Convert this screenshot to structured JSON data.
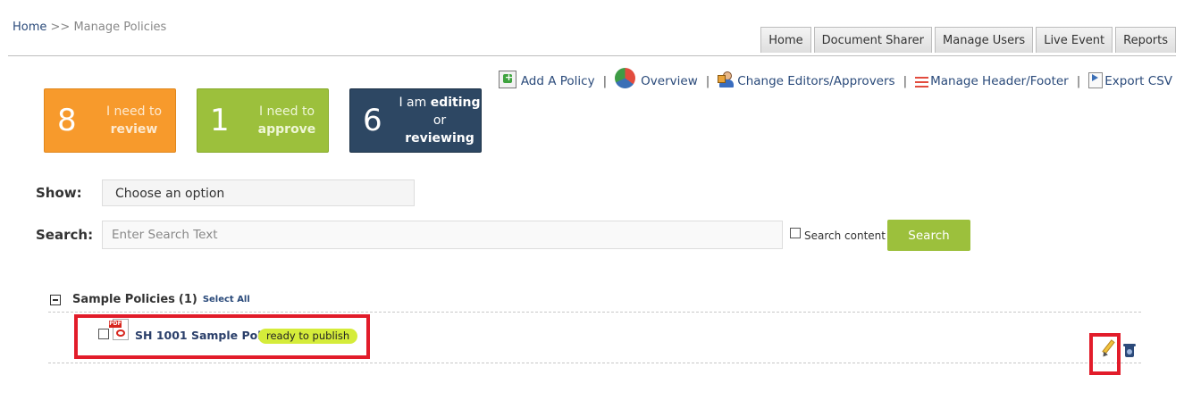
{
  "breadcrumb": {
    "home": "Home",
    "separator": ">>",
    "current": "Manage Policies"
  },
  "topnav": [
    "Home",
    "Document Sharer",
    "Manage Users",
    "Live Event",
    "Reports"
  ],
  "actions": {
    "add_policy": "Add A Policy",
    "overview": "Overview",
    "change_editors": "Change Editors/Approvers",
    "manage_header_footer": "Manage Header/Footer",
    "export_csv": "Export CSV",
    "separator": "|"
  },
  "tiles": {
    "review": {
      "count": "8",
      "line1": "I need to",
      "line2": "review",
      "color": "#f79a2c"
    },
    "approve": {
      "count": "1",
      "line1": "I need to",
      "line2": "approve",
      "color": "#9cc03c"
    },
    "editing": {
      "count": "6",
      "pre1": "I am",
      "bold1": "editing",
      "pre2": "or",
      "bold2": "reviewing",
      "color": "#2d4763"
    }
  },
  "filters": {
    "show_label": "Show:",
    "show_value": "Choose an option",
    "search_label": "Search:",
    "search_placeholder": "Enter Search Text",
    "search_content_label": "Search content",
    "search_button": "Search"
  },
  "group": {
    "title": "Sample Policies",
    "count": "(1)",
    "select_all": "Select All",
    "policies": [
      {
        "name": "SH 1001 Sample Policy",
        "status": "ready to publish",
        "status_color": "#d5ec3a"
      }
    ]
  },
  "highlight_color": "#e21c2a"
}
